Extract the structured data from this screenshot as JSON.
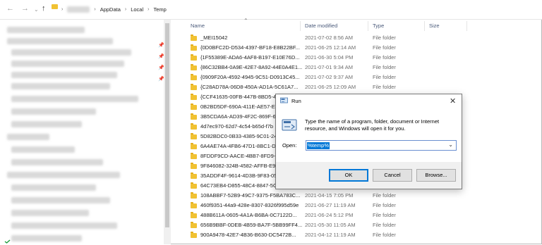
{
  "window": {
    "breadcrumb": [
      "AppData",
      "Local",
      "Temp"
    ]
  },
  "columns": {
    "name": "Name",
    "date": "Date modified",
    "type": "Type",
    "size": "Size"
  },
  "files": [
    {
      "name": "_MEI15042",
      "date": "2021-07-02 8:56 AM",
      "type": "File folder"
    },
    {
      "name": "{0D0BFC2D-D534-4397-BF18-E8B22BF...",
      "date": "2021-06-25 12:14 AM",
      "type": "File folder"
    },
    {
      "name": "{1F55389E-ADA6-4AF8-B197-E10E76D...",
      "date": "2021-06-30 5:04 PM",
      "type": "File folder"
    },
    {
      "name": "{86C32BB4-0A9E-42E7-8A92-44E0A4E1...",
      "date": "2021-07-01 9:34 AM",
      "type": "File folder"
    },
    {
      "name": "{0909F20A-4592-4945-9C51-D0913C45...",
      "date": "2021-07-02 9:37 AM",
      "type": "File folder"
    },
    {
      "name": "{C28AD78A-06D8-450A-AD1A-5C61A7...",
      "date": "2021-06-25 12:09 AM",
      "type": "File folder"
    },
    {
      "name": "{CCF41635-00FB-447B-8BD5-49",
      "date": "",
      "type": ""
    },
    {
      "name": "0B2BD5DF-690A-411E-AE57-EC",
      "date": "",
      "type": ""
    },
    {
      "name": "3B5CDA6A-AD39-4F2C-869F-6",
      "date": "",
      "type": ""
    },
    {
      "name": "4d7ec970-62d7-4c54-b65d-f7b",
      "date": "",
      "type": ""
    },
    {
      "name": "5D82BDC0-0B33-4385-9C01-24",
      "date": "",
      "type": ""
    },
    {
      "name": "6A4AE74A-4FB6-47D1-8BC1-DI",
      "date": "",
      "type": ""
    },
    {
      "name": "8FDDF9CD-AACE-4BB7-8FD9-5",
      "date": "",
      "type": ""
    },
    {
      "name": "9F846082-324B-4582-AFFB-E9A",
      "date": "",
      "type": ""
    },
    {
      "name": "35ADDF4F-9614-4D3B-9F83-05",
      "date": "",
      "type": ""
    },
    {
      "name": "64C73EB4-D855-48C4-8847-5C",
      "date": "",
      "type": ""
    },
    {
      "name": "108ABBF7-52B9-49C7-9375-F5BA783C...",
      "date": "2021-04-15 7:05 PM",
      "type": "File folder"
    },
    {
      "name": "460f9351-44a9-428e-8307-8326f995d59e",
      "date": "2021-06-27 11:19 AM",
      "type": "File folder"
    },
    {
      "name": "488B611A-0605-4A1A-B6BA-0C7122D...",
      "date": "2021-06-24 5:12 PM",
      "type": "File folder"
    },
    {
      "name": "656B9BBF-0DEB-4B59-BA7F-5BB99FF4...",
      "date": "2021-05-30 11:05 AM",
      "type": "File folder"
    },
    {
      "name": "900A9478-42E7-4B36-B630-DC5472B...",
      "date": "2021-04-12 11:19 AM",
      "type": "File folder"
    }
  ],
  "run_dialog": {
    "title": "Run",
    "close": "✕",
    "prompt": "Type the name of a program, folder, document or Internet resource, and Windows will open it for you.",
    "open_label": "Open:",
    "open_value": "%temp%",
    "ok": "OK",
    "cancel": "Cancel",
    "browse": "Browse..."
  }
}
